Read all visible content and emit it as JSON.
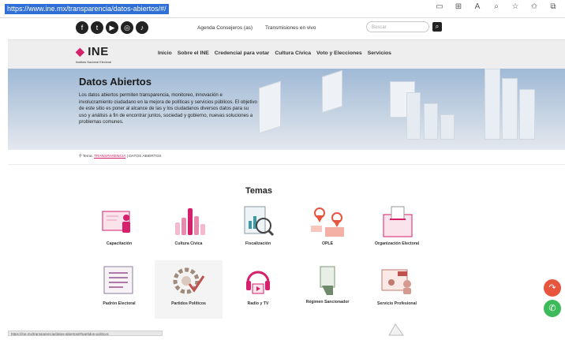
{
  "browser": {
    "url": "https://www.ine.mx/transparencia/datos-abiertos/#/",
    "toolbar_icons": [
      "reader-view-icon",
      "grid-icon",
      "read-aloud-icon",
      "zoom-icon",
      "favorite-add-icon",
      "favorites-icon",
      "collections-icon"
    ]
  },
  "topbar": {
    "social": [
      {
        "name": "facebook-icon",
        "glyph": "f"
      },
      {
        "name": "twitter-icon",
        "glyph": "t"
      },
      {
        "name": "youtube-icon",
        "glyph": "▶"
      },
      {
        "name": "instagram-icon",
        "glyph": "◎"
      },
      {
        "name": "tiktok-icon",
        "glyph": "♪"
      }
    ],
    "link_agenda": "Agenda Consejeros (as)",
    "link_transmisiones": "Transmisiones en vivo",
    "search_placeholder": "Buscar"
  },
  "nav": {
    "logo_text": "INE",
    "logo_subtitle": "Instituto Nacional Electoral",
    "items": [
      "Inicio",
      "Sobre el INE",
      "Credencial para votar",
      "Cultura Cívica",
      "Voto y Elecciones",
      "Servicios"
    ]
  },
  "hero": {
    "title": "Datos Abiertos",
    "text": "Los datos abiertos permiten transparencia, monitoreo, innovación e involucramiento ciudadano en la mejora de políticas y servicios públicos. El objetivo de este sitio es poner al alcance de las y los ciudadanos diversos datos para su uso y análisis a fin de encontrar juntos, sociedad y gobierno, nuevas soluciones a problemas comunes."
  },
  "breadcrumb": {
    "prefix": "Tema:",
    "link": "TRANSPARENCIA",
    "current": "DATOS ABIERTOS"
  },
  "temas": {
    "title": "Temas",
    "items": [
      {
        "label": "Capacitación",
        "icon": "training-icon"
      },
      {
        "label": "Cultura Cívica",
        "icon": "raised-hands-icon"
      },
      {
        "label": "Fiscalización",
        "icon": "audit-magnifier-icon"
      },
      {
        "label": "OPLE",
        "icon": "map-pins-icon"
      },
      {
        "label": "Organización Electoral",
        "icon": "ballot-box-icon"
      },
      {
        "label": "Padrón Electoral",
        "icon": "voter-registry-icon"
      },
      {
        "label": "Partidos Políticos",
        "icon": "gear-check-icon"
      },
      {
        "label": "Radio y TV",
        "icon": "radio-tv-icon"
      },
      {
        "label": "Régimen Sancionador",
        "icon": "gavel-icon"
      },
      {
        "label": "Servicio Profesional",
        "icon": "professional-service-icon"
      }
    ]
  },
  "colors": {
    "brand_pink": "#d5216b",
    "share_button": "#e8553f",
    "whatsapp_button": "#3dbb5b"
  },
  "statusbar": {
    "text": "https://ine.mx/transparencia/datos-abiertos/#/partidos-politicos"
  }
}
